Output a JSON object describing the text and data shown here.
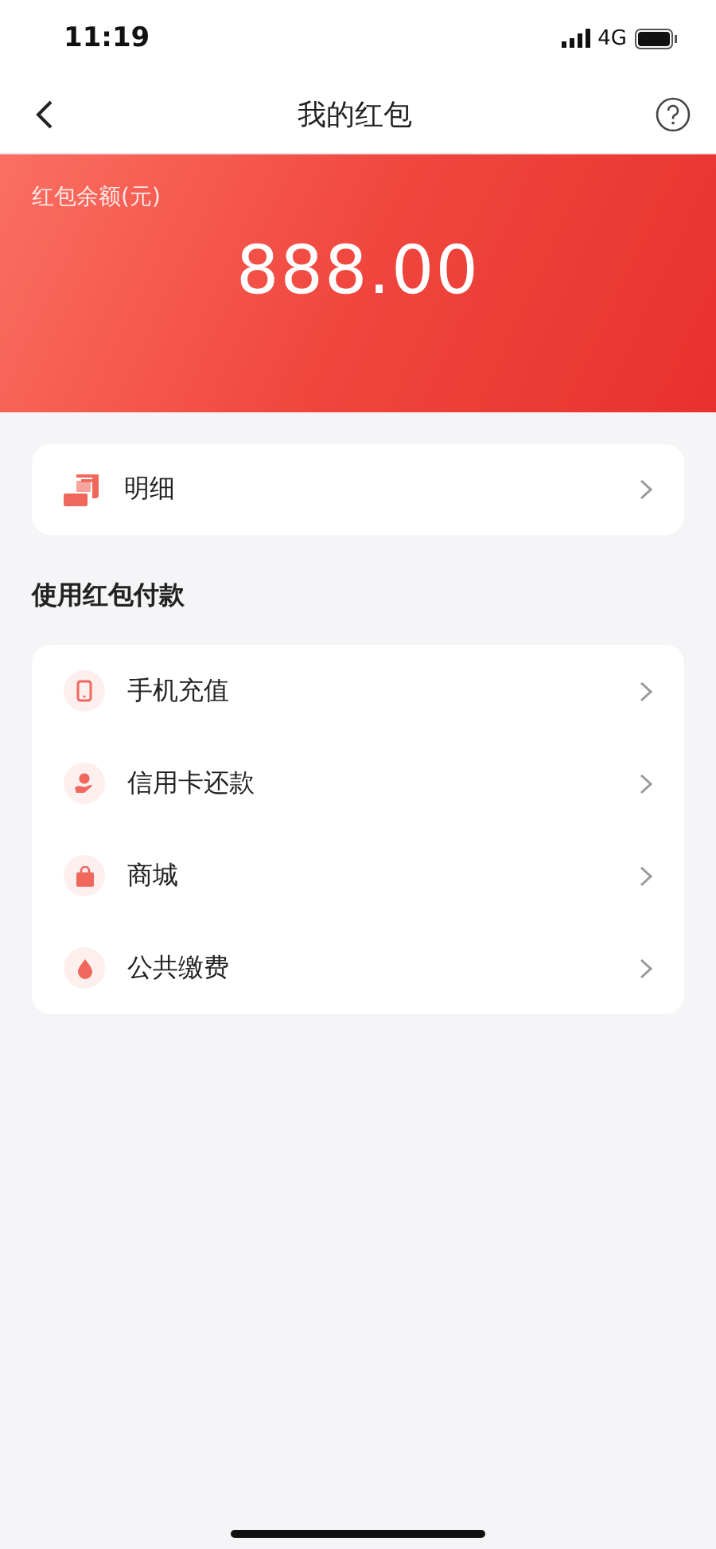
{
  "status_bar": {
    "time": "11:19",
    "network": "4G"
  },
  "nav": {
    "title": "我的红包"
  },
  "balance": {
    "label": "红包余额(元)",
    "amount": "888.00"
  },
  "detail": {
    "label": "明细"
  },
  "section_title": "使用红包付款",
  "payments": [
    {
      "kind": "phone",
      "label": "手机充值"
    },
    {
      "kind": "card",
      "label": "信用卡还款"
    },
    {
      "kind": "bag",
      "label": "商城"
    },
    {
      "kind": "drop",
      "label": "公共缴费"
    }
  ]
}
